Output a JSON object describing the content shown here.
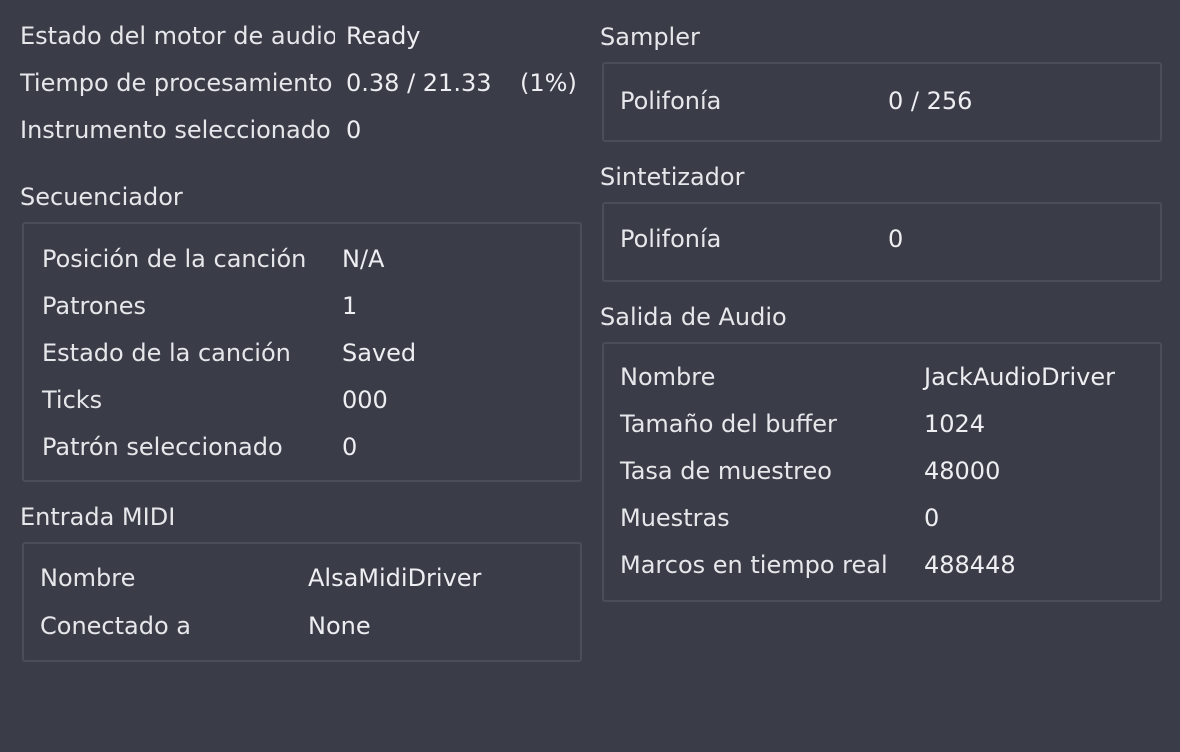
{
  "status": {
    "engine_label": "Estado del motor de audio",
    "engine_value": "Ready",
    "proc_label": "Tiempo de procesamiento",
    "proc_value": "0.38 / 21.33",
    "proc_pct": "(1%)",
    "instrument_label": "Instrumento seleccionado",
    "instrument_value": "0"
  },
  "sequencer": {
    "title": "Secuenciador",
    "rows": [
      {
        "label": "Posición de la canción",
        "value": "N/A"
      },
      {
        "label": "Patrones",
        "value": "1"
      },
      {
        "label": "Estado de la canción",
        "value": "Saved"
      },
      {
        "label": "Ticks",
        "value": "000"
      },
      {
        "label": "Patrón seleccionado",
        "value": "0"
      }
    ]
  },
  "midi": {
    "title": "Entrada MIDI",
    "rows": [
      {
        "label": "Nombre",
        "value": "AlsaMidiDriver"
      },
      {
        "label": "Conectado a",
        "value": "None"
      }
    ]
  },
  "sampler": {
    "title": "Sampler",
    "polyphony_label": "Polifonía",
    "polyphony_value": "0 / 256"
  },
  "synth": {
    "title": "Sintetizador",
    "polyphony_label": "Polifonía",
    "polyphony_value": "0"
  },
  "audio_out": {
    "title": "Salida de Audio",
    "rows": [
      {
        "label": "Nombre",
        "value": "JackAudioDriver"
      },
      {
        "label": "Tamaño del buffer",
        "value": "1024"
      },
      {
        "label": "Tasa de muestreo",
        "value": "48000"
      },
      {
        "label": "Muestras",
        "value": "0"
      },
      {
        "label": "Marcos en tiempo real",
        "value": "488448"
      }
    ]
  }
}
